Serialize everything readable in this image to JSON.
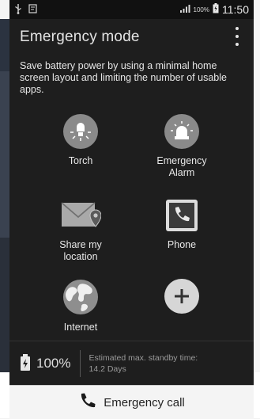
{
  "statusbar": {
    "battery_percent": "100%",
    "time": "11:50",
    "icons": [
      "usb-icon",
      "notification-icon",
      "signal-icon",
      "battery-icon"
    ]
  },
  "header": {
    "title": "Emergency mode",
    "menu_icon": "overflow-menu-icon"
  },
  "description": "Save battery power by using a minimal home screen layout and limiting the number of usable apps.",
  "apps": [
    {
      "label_line1": "Torch",
      "label_line2": "",
      "icon": "torch-icon"
    },
    {
      "label_line1": "Emergency",
      "label_line2": "Alarm",
      "icon": "alarm-icon"
    },
    {
      "label_line1": "Share my",
      "label_line2": "location",
      "icon": "share-location-icon"
    },
    {
      "label_line1": "Phone",
      "label_line2": "",
      "icon": "phone-icon"
    },
    {
      "label_line1": "Internet",
      "label_line2": "",
      "icon": "globe-icon"
    },
    {
      "label_line1": "",
      "label_line2": "",
      "icon": "add-icon"
    }
  ],
  "battery": {
    "percent": "100%",
    "standby_line1": "Estimated max. standby time:",
    "standby_line2": "14.2 Days"
  },
  "emergency_call": {
    "label": "Emergency call",
    "icon": "phone-icon"
  },
  "colors": {
    "background": "#1e1e1e",
    "icon_circle": "#8a8a8a",
    "text": "#e6e6e6",
    "emergency_bar": "#f4f4f4"
  }
}
